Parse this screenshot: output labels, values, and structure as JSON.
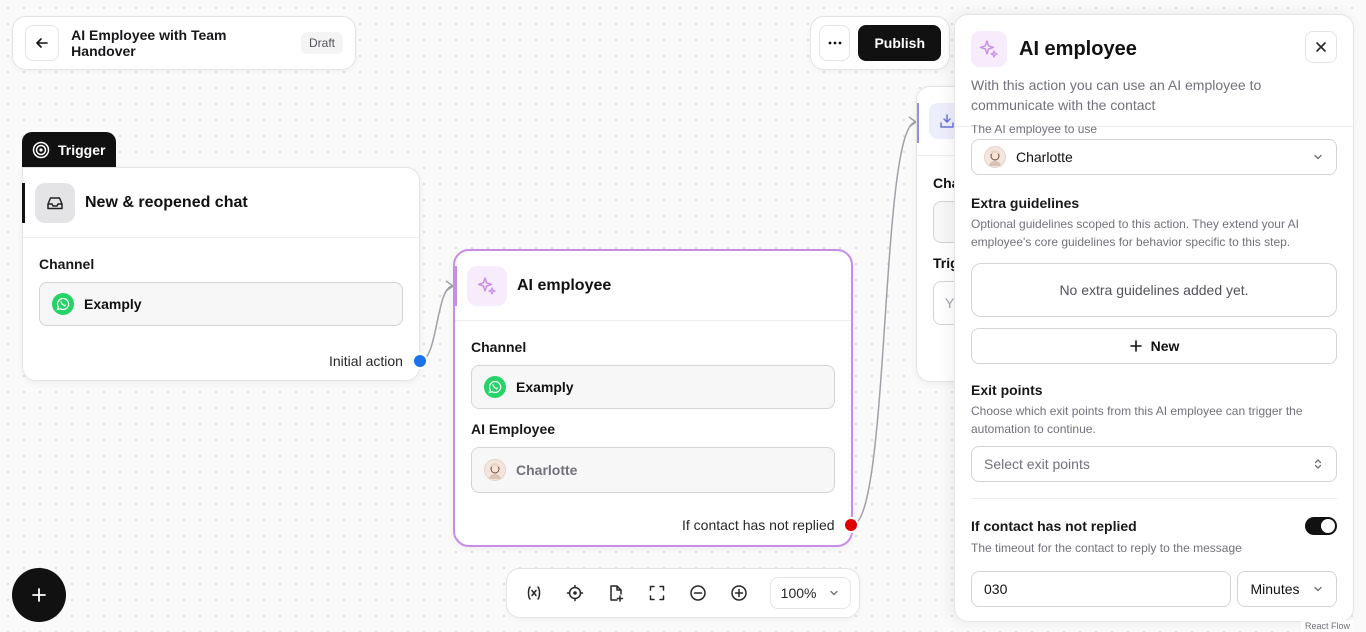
{
  "header": {
    "title": "AI Employee with Team Handover",
    "status_badge": "Draft",
    "publish_label": "Publish"
  },
  "trigger_node": {
    "tab_label": "Trigger",
    "title": "New & reopened chat",
    "channel_label": "Channel",
    "channel_value": "Examply",
    "output_label": "Initial action"
  },
  "ai_node": {
    "title": "AI employee",
    "channel_label": "Channel",
    "channel_value": "Examply",
    "employee_label": "AI Employee",
    "employee_value": "Charlotte",
    "output_label": "If contact has not replied"
  },
  "partial_node": {
    "text1": "Cha",
    "text2": "Trig",
    "text3": "Y"
  },
  "toolbar": {
    "zoom": "100%"
  },
  "panel": {
    "title": "AI employee",
    "description": "With this action you can use an AI employee to communicate with the contact",
    "employee_label": "The AI employee to use",
    "employee_value": "Charlotte",
    "guidelines_title": "Extra guidelines",
    "guidelines_desc": "Optional guidelines scoped to this action. They extend your AI employee's core guidelines for behavior specific to this step.",
    "guidelines_empty": "No extra guidelines added yet.",
    "new_label": "New",
    "exit_title": "Exit points",
    "exit_desc": "Choose which exit points from this AI employee can trigger the automation to continue.",
    "exit_placeholder": "Select exit points",
    "noreply_title": "If contact has not replied",
    "noreply_desc": "The timeout for the contact to reply to the message",
    "timeout_value": "030",
    "timeout_unit": "Minutes"
  },
  "footer": {
    "attribution": "React Flow"
  },
  "colors": {
    "accent_purple": "#c88ee6",
    "whatsapp_green": "#25d366",
    "handle_blue": "#1a73e8",
    "handle_red": "#e00000",
    "primary_dark": "#111111"
  }
}
